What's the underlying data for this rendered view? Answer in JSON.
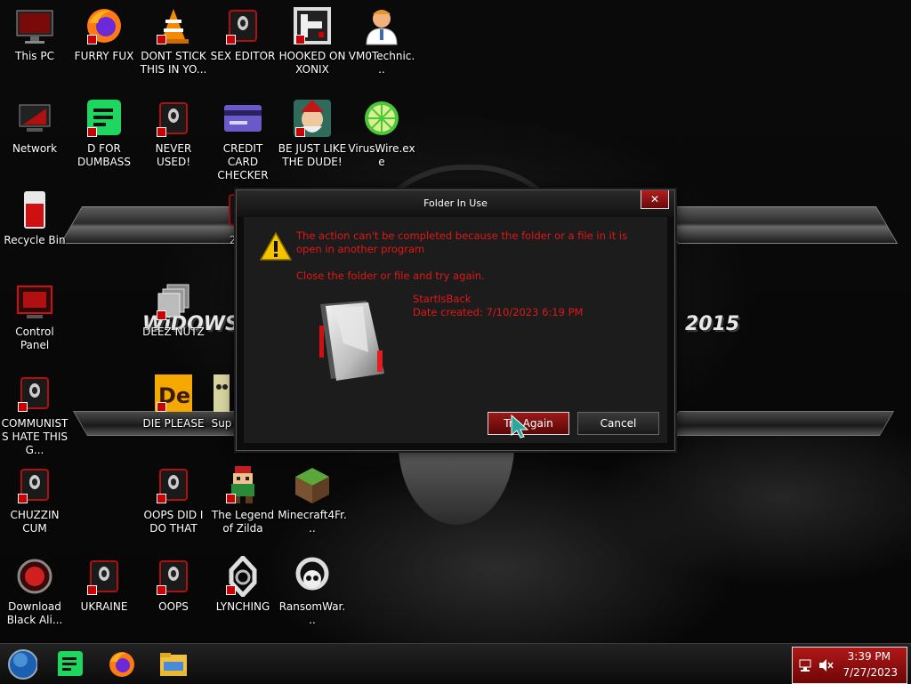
{
  "desktop": {
    "wallpaper_text_left": "WiDOWS 8",
    "wallpaper_text_right": "2015",
    "icons": [
      {
        "label": "This PC",
        "icon": "monitor-icon"
      },
      {
        "label": "FURRY FUX",
        "icon": "firefox-icon"
      },
      {
        "label": "DONT STICK THIS IN YO...",
        "icon": "vlc-cone-icon"
      },
      {
        "label": "SEX EDITOR",
        "icon": "alienware-app-icon"
      },
      {
        "label": "HOOKED ON XONIX",
        "icon": "xonix-game-icon"
      },
      {
        "label": "VM0Technic...",
        "icon": "doctor-icon"
      },
      {
        "label": "Network",
        "icon": "network-icon"
      },
      {
        "label": "D FOR DUMBASS",
        "icon": "green-chat-icon"
      },
      {
        "label": "NEVER USED!",
        "icon": "alienware-app-icon"
      },
      {
        "label": "CREDIT CARD CHECKER",
        "icon": "credit-card-icon"
      },
      {
        "label": "BE JUST LIKE THE DUDE!",
        "icon": "elf-icon"
      },
      {
        "label": "VirusWire.exe",
        "icon": "lime-icon"
      },
      {
        "label": "Recycle Bin",
        "icon": "recycle-bin-icon"
      },
      {
        "label": "2PAC",
        "icon": "alienware-app-icon"
      },
      {
        "label": "Control Panel",
        "icon": "control-panel-icon"
      },
      {
        "label": "DEEZ NUTZ",
        "icon": "stack-icon"
      },
      {
        "label": "COMMUNISTS HATE THIS G...",
        "icon": "alienware-app-icon"
      },
      {
        "label": "DIE PLEASE",
        "icon": "de-logo-icon"
      },
      {
        "label": "Sup",
        "icon": "skull-icon"
      },
      {
        "label": "CHUZZIN CUM",
        "icon": "alienware-app-icon"
      },
      {
        "label": "OOPS DID I DO THAT",
        "icon": "alienware-app-icon"
      },
      {
        "label": "The Legend of Zilda",
        "icon": "pixel-hero-icon"
      },
      {
        "label": "Minecraft4Fr...",
        "icon": "grass-block-icon"
      },
      {
        "label": "Download Black Ali...",
        "icon": "red-orb-icon"
      },
      {
        "label": "UKRAINE",
        "icon": "alienware-app-icon"
      },
      {
        "label": "OOPS",
        "icon": "alienware-app-icon"
      },
      {
        "label": "LYNCHING",
        "icon": "rope-icon"
      },
      {
        "label": "RansomWar...",
        "icon": "skull-ring-icon"
      }
    ]
  },
  "dialog": {
    "title": "Folder In Use",
    "message": "The action can't be completed because the folder or a file in it is open in another program",
    "hint": "Close the folder or file and try again.",
    "file_name": "StartIsBack",
    "file_date": "Date created: 7/10/2023 6:19 PM",
    "try_again_label": "Try Again",
    "cancel_label": "Cancel",
    "close_glyph": "✕",
    "warning_icon": "warning-icon",
    "folder_icon": "folder-icon"
  },
  "taskbar": {
    "items": [
      "start-orb-icon",
      "green-chat-icon",
      "firefox-icon",
      "file-explorer-icon"
    ],
    "tray": {
      "time": "3:39 PM",
      "date": "7/27/2023",
      "icons": [
        "network-tray-icon",
        "volume-muted-icon"
      ]
    }
  },
  "colors": {
    "error_text": "#e01818",
    "accent_red": "#9a1a1a",
    "dialog_body": "#1c1c1c"
  }
}
